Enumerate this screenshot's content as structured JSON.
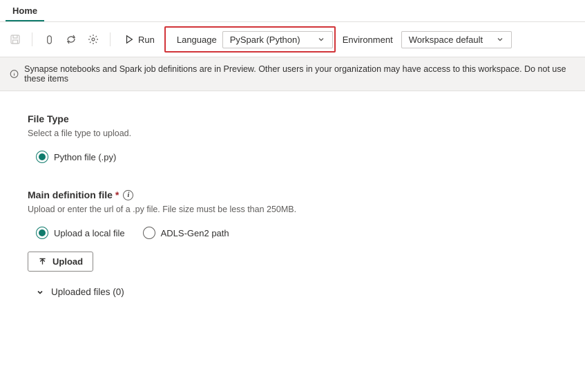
{
  "tabs": {
    "home": "Home"
  },
  "toolbar": {
    "run_label": "Run",
    "language_label": "Language",
    "language_value": "PySpark (Python)",
    "environment_label": "Environment",
    "environment_value": "Workspace default"
  },
  "banner": {
    "text": "Synapse notebooks and Spark job definitions are in Preview. Other users in your organization may have access to this workspace. Do not use these items"
  },
  "file_type": {
    "title": "File Type",
    "desc": "Select a file type to upload.",
    "options": {
      "python": "Python file (.py)"
    }
  },
  "main_def": {
    "title": "Main definition file",
    "desc": "Upload or enter the url of a .py file. File size must be less than 250MB.",
    "options": {
      "local": "Upload a local file",
      "adls": "ADLS-Gen2 path"
    },
    "upload_label": "Upload",
    "uploaded_label": "Uploaded files (0)"
  }
}
